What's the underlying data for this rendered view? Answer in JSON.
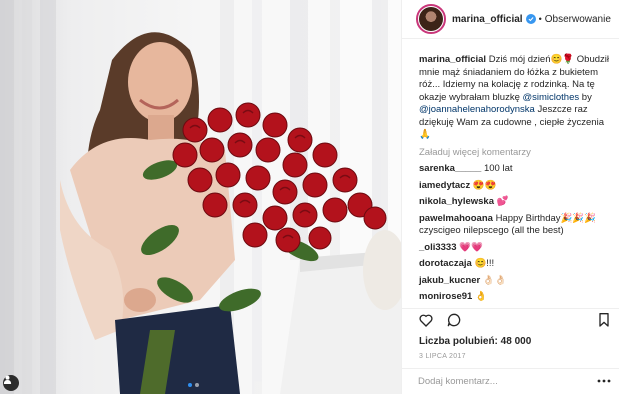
{
  "header": {
    "username": "marina_official",
    "separator": "•",
    "follow_label": "Obserwowanie"
  },
  "caption": {
    "username": "marina_official",
    "text1": "Dziś mój dzień😊🌹 Obudził mnie mąż śniadaniem do łóżka z bukietem róż... Idziemy na kolację z rodzinką. Na tę okazje wybrałam bluzkę",
    "mention1": "@simiclothes",
    "text2": " by ",
    "mention2": "@joannahelenahorodynska",
    "text3": " Jeszcze raz dziękuję Wam za cudowne , ciepłe życzenia🙏"
  },
  "load_more_label": "Załaduj więcej komentarzy",
  "comments": [
    {
      "user": "sarenka_____",
      "text": "100 lat"
    },
    {
      "user": "iamedytacz",
      "text": "😍😍"
    },
    {
      "user": "nikola_hylewska",
      "text": "💕"
    },
    {
      "user": "pawelmahooana",
      "text": "Happy Birthday🎉🎉🎉 czyscigeo nilepscego (all the best)"
    },
    {
      "user": "_oli3333",
      "text": "💗💗"
    },
    {
      "user": "dorotaczaja",
      "text": "😊!!!"
    },
    {
      "user": "jakub_kucner",
      "text": "👌🏻👌🏻"
    },
    {
      "user": "monirose91",
      "text": "👌"
    }
  ],
  "likes_label": "Liczba polubień: 48 000",
  "date": "3 LIPCA 2017",
  "add_comment_placeholder": "Dodaj komentarz...",
  "icons": [
    "heart-icon",
    "comment-icon",
    "bookmark-icon",
    "more-options-icon",
    "user-tag-icon",
    "verified-icon"
  ],
  "colors": {
    "verified": "#3897f0",
    "mention": "#003569",
    "roses": "#b3121c",
    "carousel_active": "#2f8ff0"
  }
}
